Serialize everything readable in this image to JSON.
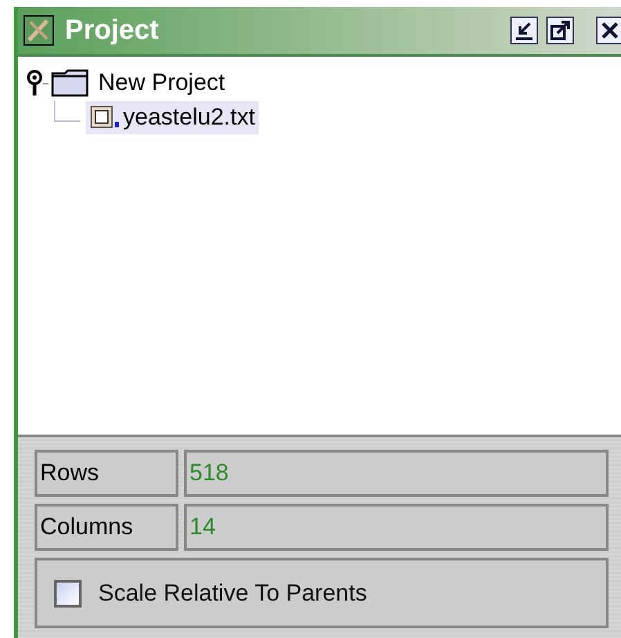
{
  "window": {
    "title": "Project"
  },
  "tree": [
    {
      "label": "New Project",
      "expanded": true,
      "children": [
        {
          "label": "yeastelu2.txt",
          "selected": true
        }
      ]
    }
  ],
  "properties": [
    {
      "label": "Rows",
      "value": "518"
    },
    {
      "label": "Columns",
      "value": "14"
    }
  ],
  "options": [
    {
      "label": "Scale Relative To Parents",
      "checked": false
    }
  ]
}
